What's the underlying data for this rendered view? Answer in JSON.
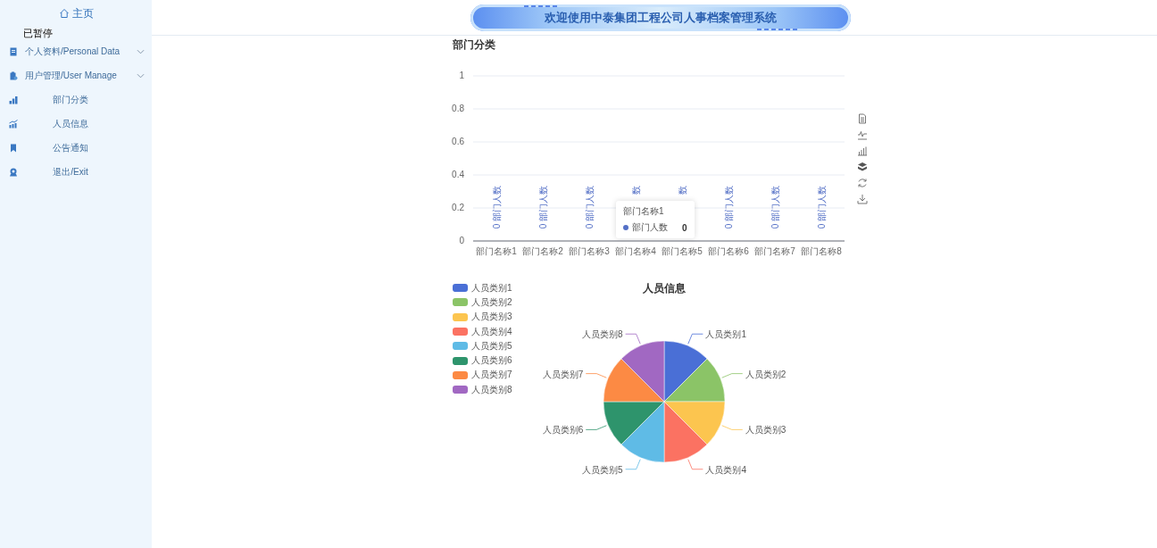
{
  "sidebar": {
    "home": "主页",
    "items": [
      {
        "label": "个人资料/Personal Data",
        "kind": "group",
        "expanded": false
      },
      {
        "label": "用户管理/User Manage",
        "kind": "group",
        "expanded": false
      },
      {
        "label": "部门分类",
        "kind": "link"
      },
      {
        "label": "人员信息",
        "kind": "link"
      },
      {
        "label": "公告通知",
        "kind": "link"
      },
      {
        "label": "退出/Exit",
        "kind": "link"
      }
    ]
  },
  "video_overlay": "已暂停",
  "header": {
    "title": "欢迎使用中泰集团工程公司人事档案管理系统"
  },
  "department_chart": {
    "title": "部门分类",
    "chart_data": {
      "type": "bar",
      "categories": [
        "部门名称1",
        "部门名称2",
        "部门名称3",
        "部门名称4",
        "部门名称5",
        "部门名称6",
        "部门名称7",
        "部门名称8"
      ],
      "series": [
        {
          "name": "部门人数",
          "color": "#5470c6",
          "values": [
            0,
            0,
            0,
            0,
            0,
            0,
            0,
            0
          ]
        }
      ],
      "ylim": [
        0,
        1
      ],
      "yticks": [
        0,
        0.2,
        0.4,
        0.6,
        0.8,
        1
      ],
      "grid": true
    },
    "bar_labels": [
      "0 部门人数",
      "0 部门人数",
      "0 部门人数",
      "数",
      "数",
      "0 部门人数",
      "0 部门人数",
      "0 部门人数"
    ],
    "tooltip": {
      "title": "部门名称1",
      "value": "0",
      "color": "#5470c6"
    }
  },
  "personnel_chart": {
    "chart_data": {
      "type": "pie",
      "title": "人员信息",
      "categories": [
        "人员类别1",
        "人员类别2",
        "人员类别3",
        "人员类别4",
        "人员类别5",
        "人员类别6",
        "人员类别7",
        "人员类别8"
      ],
      "values": [
        1,
        1,
        1,
        1,
        1,
        1,
        1,
        1
      ]
    },
    "legend": [
      {
        "label": "人员类别1",
        "color": "#4a6fd6"
      },
      {
        "label": "人员类别2",
        "color": "#8bc467"
      },
      {
        "label": "人员类别3",
        "color": "#fcc54f"
      },
      {
        "label": "人员类别4",
        "color": "#fb7262"
      },
      {
        "label": "人员类别5",
        "color": "#5fbbe6"
      },
      {
        "label": "人员类别6",
        "color": "#2e946c"
      },
      {
        "label": "人员类别7",
        "color": "#fc8a44"
      },
      {
        "label": "人员类别8",
        "color": "#a168c2"
      }
    ]
  }
}
